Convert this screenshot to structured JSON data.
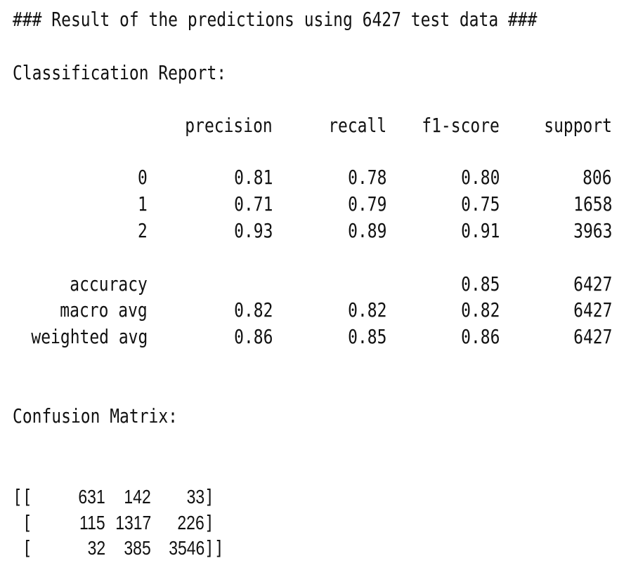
{
  "header": {
    "title": "### Result of the predictions using 6427 test data ###"
  },
  "classification_report": {
    "heading": "Classification Report:",
    "columns": {
      "precision": "precision",
      "recall": "recall",
      "f1": "f1-score",
      "support": "support"
    },
    "class_rows": [
      {
        "label": "0",
        "precision": "0.81",
        "recall": "0.78",
        "f1": "0.80",
        "support": "806"
      },
      {
        "label": "1",
        "precision": "0.71",
        "recall": "0.79",
        "f1": "0.75",
        "support": "1658"
      },
      {
        "label": "2",
        "precision": "0.93",
        "recall": "0.89",
        "f1": "0.91",
        "support": "3963"
      }
    ],
    "summary_rows": [
      {
        "label": "accuracy",
        "precision": "",
        "recall": "",
        "f1": "0.85",
        "support": "6427"
      },
      {
        "label": "macro avg",
        "precision": "0.82",
        "recall": "0.82",
        "f1": "0.82",
        "support": "6427"
      },
      {
        "label": "weighted avg",
        "precision": "0.86",
        "recall": "0.85",
        "f1": "0.86",
        "support": "6427"
      }
    ]
  },
  "confusion_matrix": {
    "heading": "Confusion Matrix:",
    "rows": [
      {
        "open": "[[",
        "values": [
          "631",
          "142",
          "33"
        ],
        "close": "]"
      },
      {
        "open": " [",
        "values": [
          "115",
          "1317",
          "226"
        ],
        "close": "]"
      },
      {
        "open": " [",
        "values": [
          "32",
          "385",
          "3546"
        ],
        "close": "]]"
      }
    ]
  }
}
